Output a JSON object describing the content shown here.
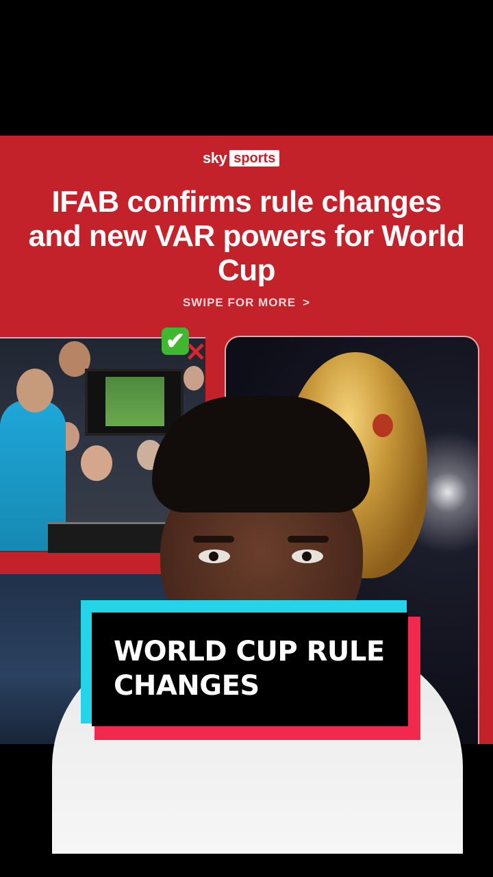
{
  "graphic": {
    "brand_left": "sky",
    "brand_right": "sports",
    "headline": "IFAB confirms rule changes and new VAR powers for World Cup",
    "swipe_label": "SWIPE FOR MORE",
    "swipe_chevron": ">",
    "check_icon": "✔",
    "cross_icon": "✕"
  },
  "caption": {
    "text": "WORLD CUP RULE CHANGES"
  },
  "colors": {
    "graphic_red": "#c4222b",
    "caption_cyan": "#25d4e8",
    "caption_red": "#f2294e"
  }
}
